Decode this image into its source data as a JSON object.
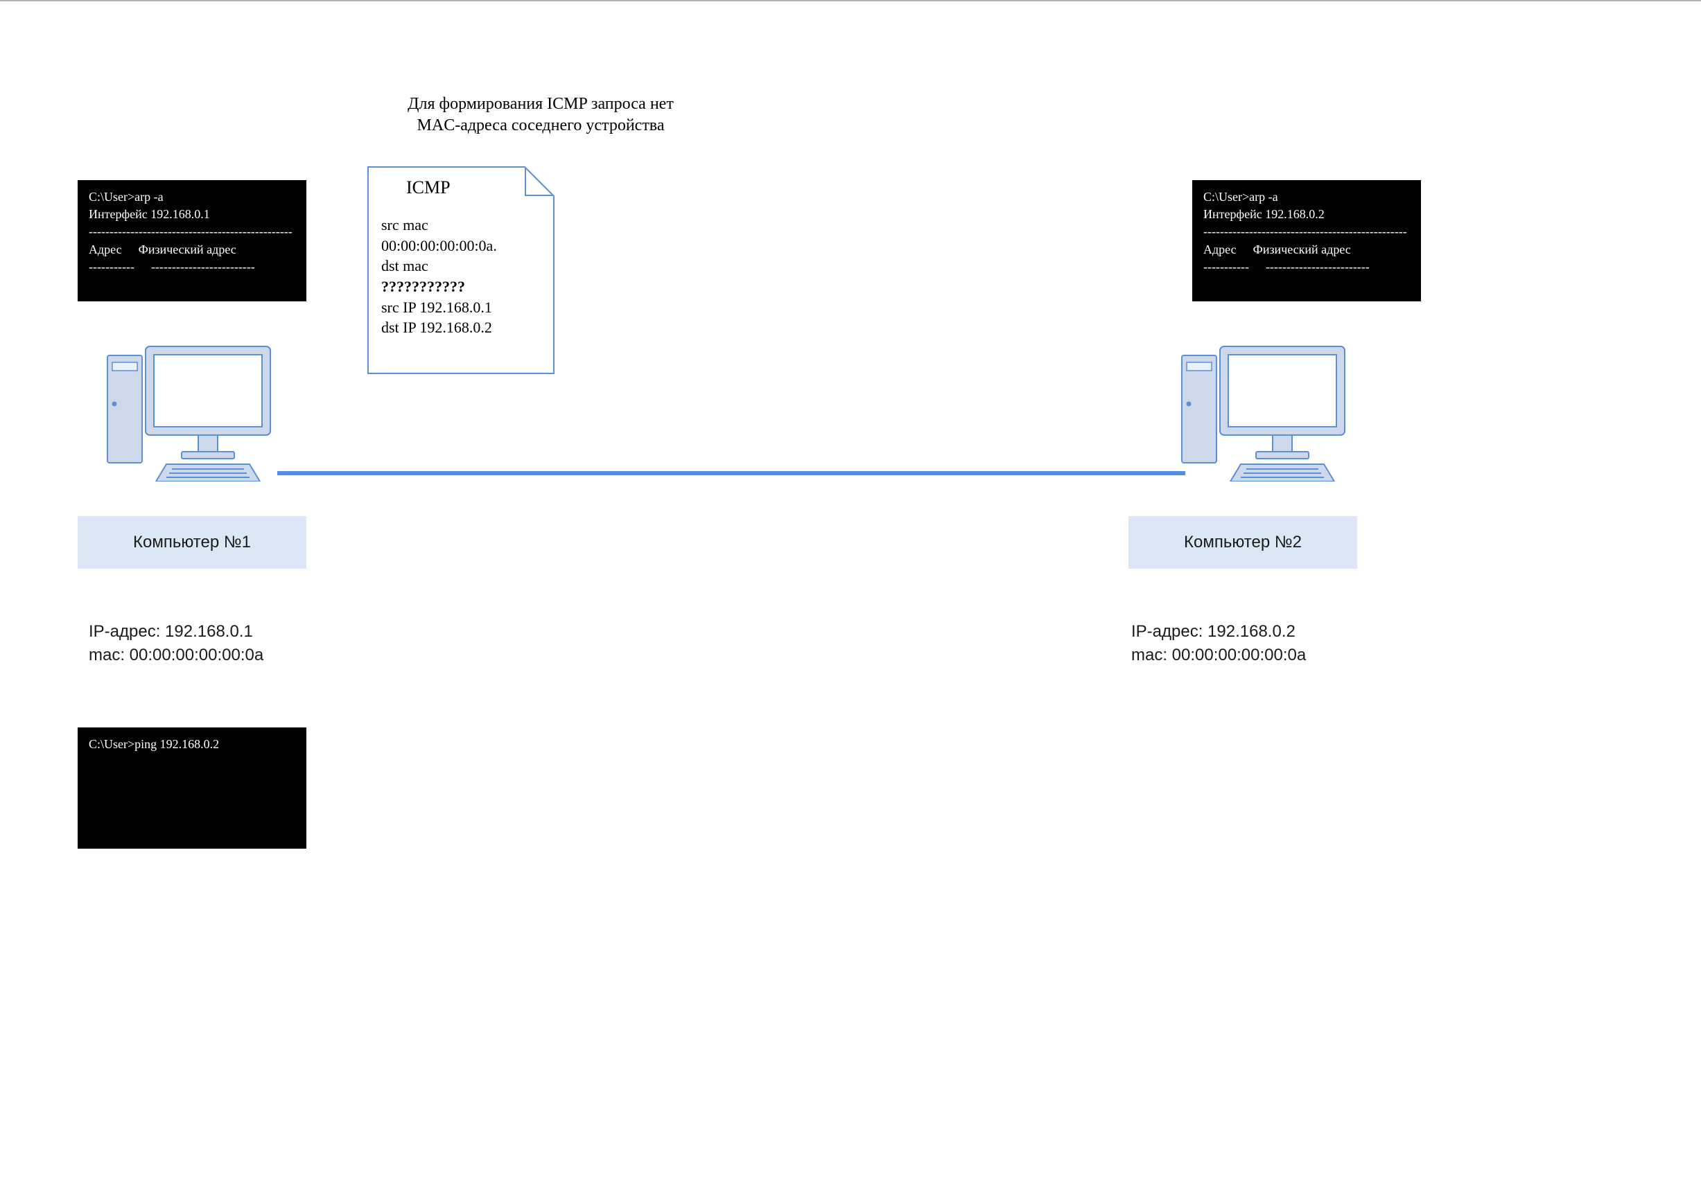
{
  "caption": {
    "line1": "Для формирования ICMP запроса нет",
    "line2": "MAC-адреса соседнего устройства"
  },
  "terminal_left_arp": {
    "cmd": "C:\\User>arp -a",
    "iface": "Интерфейс 192.168.0.1",
    "col1": "Адрес",
    "col2": "Физический адрес"
  },
  "terminal_right_arp": {
    "cmd": "C:\\User>arp -a",
    "iface": "Интерфейс 192.168.0.2",
    "col1": "Адрес",
    "col2": "Физический адрес"
  },
  "terminal_ping": {
    "cmd": "C:\\User>ping 192.168.0.2"
  },
  "icmp": {
    "title": "ICMP",
    "l1": "src mac",
    "l2": "00:00:00:00:00:0a.",
    "l3": "dst mac",
    "l4": "???????????",
    "l5": "src IP 192.168.0.1",
    "l6": "dst IP 192.168.0.2"
  },
  "pc1": {
    "label": "Компьютер №1",
    "ip": "IP-адрес: 192.168.0.1",
    "mac": "mac: 00:00:00:00:00:0a"
  },
  "pc2": {
    "label": "Компьютер №2",
    "ip": "IP-адрес: 192.168.0.2",
    "mac": "mac: 00:00:00:00:00:0a"
  }
}
